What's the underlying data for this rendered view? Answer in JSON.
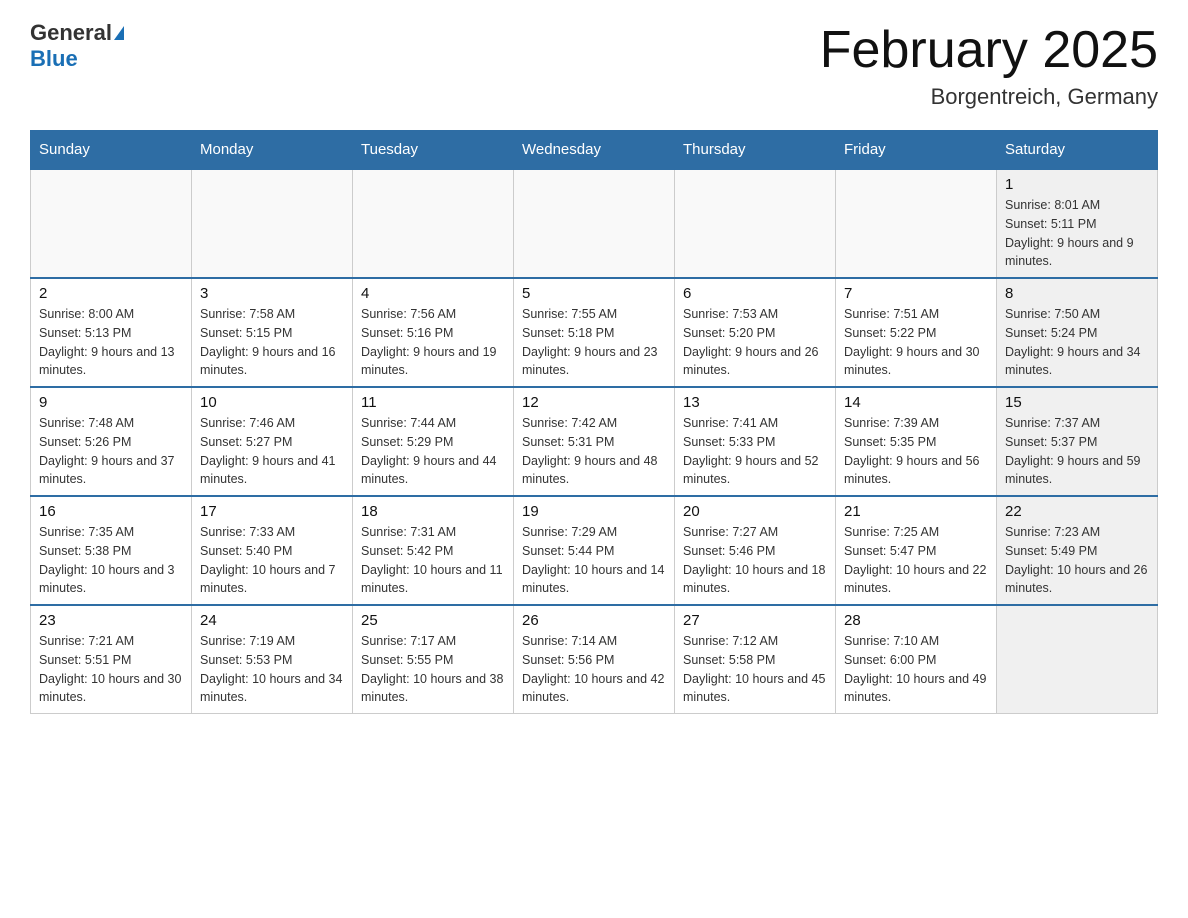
{
  "header": {
    "logo_general": "General",
    "logo_blue": "Blue",
    "title": "February 2025",
    "subtitle": "Borgentreich, Germany"
  },
  "weekdays": [
    "Sunday",
    "Monday",
    "Tuesday",
    "Wednesday",
    "Thursday",
    "Friday",
    "Saturday"
  ],
  "weeks": [
    [
      {
        "day": "",
        "info": ""
      },
      {
        "day": "",
        "info": ""
      },
      {
        "day": "",
        "info": ""
      },
      {
        "day": "",
        "info": ""
      },
      {
        "day": "",
        "info": ""
      },
      {
        "day": "",
        "info": ""
      },
      {
        "day": "1",
        "info": "Sunrise: 8:01 AM\nSunset: 5:11 PM\nDaylight: 9 hours and 9 minutes."
      }
    ],
    [
      {
        "day": "2",
        "info": "Sunrise: 8:00 AM\nSunset: 5:13 PM\nDaylight: 9 hours and 13 minutes."
      },
      {
        "day": "3",
        "info": "Sunrise: 7:58 AM\nSunset: 5:15 PM\nDaylight: 9 hours and 16 minutes."
      },
      {
        "day": "4",
        "info": "Sunrise: 7:56 AM\nSunset: 5:16 PM\nDaylight: 9 hours and 19 minutes."
      },
      {
        "day": "5",
        "info": "Sunrise: 7:55 AM\nSunset: 5:18 PM\nDaylight: 9 hours and 23 minutes."
      },
      {
        "day": "6",
        "info": "Sunrise: 7:53 AM\nSunset: 5:20 PM\nDaylight: 9 hours and 26 minutes."
      },
      {
        "day": "7",
        "info": "Sunrise: 7:51 AM\nSunset: 5:22 PM\nDaylight: 9 hours and 30 minutes."
      },
      {
        "day": "8",
        "info": "Sunrise: 7:50 AM\nSunset: 5:24 PM\nDaylight: 9 hours and 34 minutes."
      }
    ],
    [
      {
        "day": "9",
        "info": "Sunrise: 7:48 AM\nSunset: 5:26 PM\nDaylight: 9 hours and 37 minutes."
      },
      {
        "day": "10",
        "info": "Sunrise: 7:46 AM\nSunset: 5:27 PM\nDaylight: 9 hours and 41 minutes."
      },
      {
        "day": "11",
        "info": "Sunrise: 7:44 AM\nSunset: 5:29 PM\nDaylight: 9 hours and 44 minutes."
      },
      {
        "day": "12",
        "info": "Sunrise: 7:42 AM\nSunset: 5:31 PM\nDaylight: 9 hours and 48 minutes."
      },
      {
        "day": "13",
        "info": "Sunrise: 7:41 AM\nSunset: 5:33 PM\nDaylight: 9 hours and 52 minutes."
      },
      {
        "day": "14",
        "info": "Sunrise: 7:39 AM\nSunset: 5:35 PM\nDaylight: 9 hours and 56 minutes."
      },
      {
        "day": "15",
        "info": "Sunrise: 7:37 AM\nSunset: 5:37 PM\nDaylight: 9 hours and 59 minutes."
      }
    ],
    [
      {
        "day": "16",
        "info": "Sunrise: 7:35 AM\nSunset: 5:38 PM\nDaylight: 10 hours and 3 minutes."
      },
      {
        "day": "17",
        "info": "Sunrise: 7:33 AM\nSunset: 5:40 PM\nDaylight: 10 hours and 7 minutes."
      },
      {
        "day": "18",
        "info": "Sunrise: 7:31 AM\nSunset: 5:42 PM\nDaylight: 10 hours and 11 minutes."
      },
      {
        "day": "19",
        "info": "Sunrise: 7:29 AM\nSunset: 5:44 PM\nDaylight: 10 hours and 14 minutes."
      },
      {
        "day": "20",
        "info": "Sunrise: 7:27 AM\nSunset: 5:46 PM\nDaylight: 10 hours and 18 minutes."
      },
      {
        "day": "21",
        "info": "Sunrise: 7:25 AM\nSunset: 5:47 PM\nDaylight: 10 hours and 22 minutes."
      },
      {
        "day": "22",
        "info": "Sunrise: 7:23 AM\nSunset: 5:49 PM\nDaylight: 10 hours and 26 minutes."
      }
    ],
    [
      {
        "day": "23",
        "info": "Sunrise: 7:21 AM\nSunset: 5:51 PM\nDaylight: 10 hours and 30 minutes."
      },
      {
        "day": "24",
        "info": "Sunrise: 7:19 AM\nSunset: 5:53 PM\nDaylight: 10 hours and 34 minutes."
      },
      {
        "day": "25",
        "info": "Sunrise: 7:17 AM\nSunset: 5:55 PM\nDaylight: 10 hours and 38 minutes."
      },
      {
        "day": "26",
        "info": "Sunrise: 7:14 AM\nSunset: 5:56 PM\nDaylight: 10 hours and 42 minutes."
      },
      {
        "day": "27",
        "info": "Sunrise: 7:12 AM\nSunset: 5:58 PM\nDaylight: 10 hours and 45 minutes."
      },
      {
        "day": "28",
        "info": "Sunrise: 7:10 AM\nSunset: 6:00 PM\nDaylight: 10 hours and 49 minutes."
      },
      {
        "day": "",
        "info": ""
      }
    ]
  ]
}
